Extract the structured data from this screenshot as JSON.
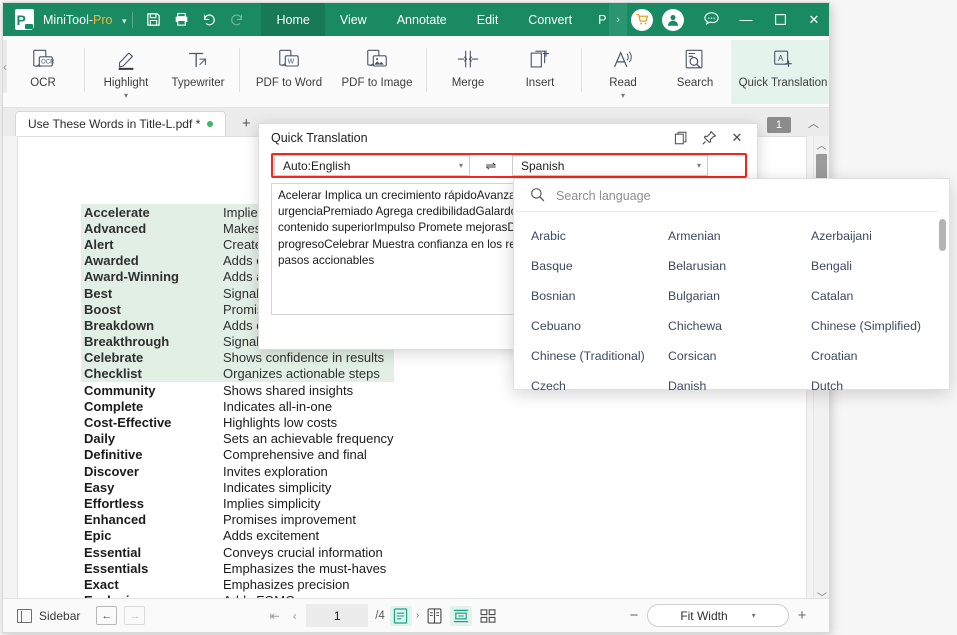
{
  "titlebar": {
    "brand_main": "MiniTool-",
    "brand_suffix": "Pro",
    "caret": "▾",
    "icons": {
      "save": "save-icon",
      "print": "print-icon",
      "undo": "↺",
      "redo": "↻"
    },
    "menu_tabs": [
      {
        "label": "Home",
        "active": true
      },
      {
        "label": "View",
        "active": false
      },
      {
        "label": "Annotate",
        "active": false
      },
      {
        "label": "Edit",
        "active": false
      },
      {
        "label": "Convert",
        "active": false
      },
      {
        "label": "P",
        "active": false
      }
    ],
    "scroll_more": "›",
    "cart": "cart-icon",
    "user": "user-icon",
    "chat": "chat-icon",
    "minimize": "—",
    "maximize": "▢",
    "close": "✕"
  },
  "ribbon": {
    "left_arrow": "‹",
    "right_arrow": "›",
    "items": [
      {
        "label": "OCR",
        "icon": "ocr-icon",
        "caret": ""
      },
      {
        "label": "Highlight",
        "icon": "highlight-icon",
        "caret": "▾"
      },
      {
        "label": "Typewriter",
        "icon": "typewriter-icon",
        "caret": ""
      },
      {
        "label": "PDF to Word",
        "icon": "pdf-to-word-icon",
        "caret": ""
      },
      {
        "label": "PDF to Image",
        "icon": "pdf-to-image-icon",
        "caret": ""
      },
      {
        "label": "Merge",
        "icon": "merge-icon",
        "caret": ""
      },
      {
        "label": "Insert",
        "icon": "insert-icon",
        "caret": ""
      },
      {
        "label": "Read",
        "icon": "read-aloud-icon",
        "caret": "▾"
      },
      {
        "label": "Search",
        "icon": "search-icon",
        "caret": ""
      },
      {
        "label": "Quick Translation",
        "icon": "quick-translation-icon",
        "caret": ""
      }
    ]
  },
  "tabstrip": {
    "doc_tab": "Use These Words in Title-L.pdf *",
    "add_tab": "+",
    "page_badge": "1",
    "collapse_caret": "︿"
  },
  "document": {
    "rows": [
      {
        "term": "Accelerate",
        "definition": "Implies a quick increase",
        "highlighted": true
      },
      {
        "term": "Advanced",
        "definition": "Makes experienced",
        "highlighted": true
      },
      {
        "term": "Alert",
        "definition": "Creates urgency",
        "highlighted": true
      },
      {
        "term": "Awarded",
        "definition": "Adds credibility",
        "highlighted": true
      },
      {
        "term": "Award-Winning",
        "definition": "Adds authority",
        "highlighted": true
      },
      {
        "term": "Best",
        "definition": "Signals top content",
        "highlighted": true
      },
      {
        "term": "Boost",
        "definition": "Promises improvements",
        "highlighted": true
      },
      {
        "term": "Breakdown",
        "definition": "Adds clarity",
        "highlighted": true
      },
      {
        "term": "Breakthrough",
        "definition": "Signals advance",
        "highlighted": true
      },
      {
        "term": "Celebrate",
        "definition": "Shows confidence in results",
        "highlighted": true
      },
      {
        "term": "Checklist",
        "definition": "Organizes actionable steps",
        "highlighted": true
      },
      {
        "term": "Community",
        "definition": "Shows shared insights",
        "highlighted": false
      },
      {
        "term": "Complete",
        "definition": "Indicates all-in-one",
        "highlighted": false
      },
      {
        "term": "Cost-Effective",
        "definition": "Highlights low costs",
        "highlighted": false
      },
      {
        "term": "Daily",
        "definition": "Sets an achievable frequency",
        "highlighted": false
      },
      {
        "term": "Definitive",
        "definition": "Comprehensive and final",
        "highlighted": false
      },
      {
        "term": "Discover",
        "definition": "Invites exploration",
        "highlighted": false
      },
      {
        "term": "Easy",
        "definition": "Indicates simplicity",
        "highlighted": false
      },
      {
        "term": "Effortless",
        "definition": "Implies simplicity",
        "highlighted": false
      },
      {
        "term": "Enhanced",
        "definition": "Promises improvement",
        "highlighted": false
      },
      {
        "term": "Epic",
        "definition": "Adds excitement",
        "highlighted": false
      },
      {
        "term": "Essential",
        "definition": "Conveys crucial information",
        "highlighted": false
      },
      {
        "term": "Essentials",
        "definition": "Emphasizes the must-haves",
        "highlighted": false
      },
      {
        "term": "Exact",
        "definition": "Emphasizes precision",
        "highlighted": false
      },
      {
        "term": "Exclusive",
        "definition": "Adds FOMO",
        "highlighted": false
      }
    ]
  },
  "quick_translation": {
    "title": "Quick Translation",
    "copy_icon": "copy-icon",
    "pin_icon": "pin-icon",
    "close_icon": "✕",
    "source_language": "Auto:English",
    "target_language": "Spanish",
    "swap_icon": "⇌",
    "caret": "▾",
    "translated_text": "Acelerar Implica un crecimiento rápidoAvanzado Hace experimentadoAlerta Crea urgenciaPremiado Agrega credibilidadGalardonado Agrega autoridadLo mejor Señala contenido superiorImpulso Promete mejorasDesglose Agrega claridadAvance Señala progresoCelebrar Muestra confianza en los resultadosLista de verificación Organiza pasos accionables",
    "highlight_color": "#f4251b"
  },
  "language_dropdown": {
    "search_placeholder": "Search language",
    "search_icon": "search-icon",
    "languages": [
      "Arabic",
      "Armenian",
      "Azerbaijani",
      "Basque",
      "Belarusian",
      "Bengali",
      "Bosnian",
      "Bulgarian",
      "Catalan",
      "Cebuano",
      "Chichewa",
      "Chinese (Simplified)",
      "Chinese (Traditional)",
      "Corsican",
      "Croatian",
      "Czech",
      "Danish",
      "Dutch"
    ]
  },
  "statusbar": {
    "sidebar_label": "Sidebar",
    "sidebar_icon": "sidebar-icon",
    "prev_page_icon": "←",
    "next_page_icon": "→",
    "first_page_icon": "⇤",
    "prev_icon": "‹",
    "current_page": "1",
    "page_total": "/4",
    "next_icon": "›",
    "view_single_icon": "single-page-view-icon",
    "view_double_icon": "double-page-view-icon",
    "view_continuous_icon": "continuous-scroll-icon",
    "view_thumbnail_icon": "thumbnail-grid-icon",
    "zoom_out": "−",
    "zoom_level": "Fit Width",
    "zoom_caret": "▾",
    "zoom_in": "+"
  }
}
